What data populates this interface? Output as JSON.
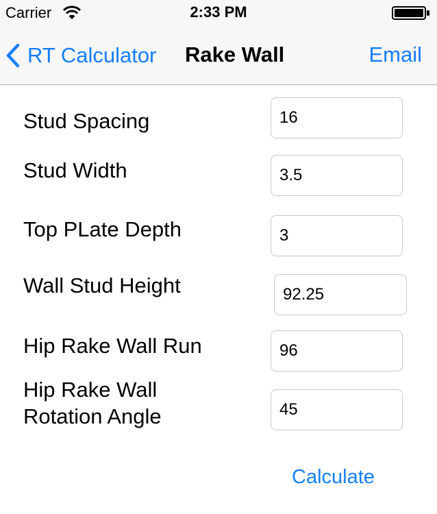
{
  "status_bar": {
    "carrier": "Carrier",
    "time": "2:33 PM"
  },
  "nav": {
    "back_label": "RT Calculator",
    "title": "Rake Wall",
    "email_label": "Email"
  },
  "form": {
    "stud_spacing": {
      "label": "Stud Spacing",
      "value": "16"
    },
    "stud_width": {
      "label": "Stud Width",
      "value": "3.5"
    },
    "top_plate_depth": {
      "label": "Top PLate Depth",
      "value": "3"
    },
    "wall_stud_height": {
      "label": "Wall Stud Height",
      "value": "92.25"
    },
    "hip_rake_wall_run": {
      "label": "Hip Rake Wall Run",
      "value": "96"
    },
    "hip_rake_wall_rotation_angle": {
      "label_line1": "Hip Rake Wall",
      "label_line2": "Rotation Angle",
      "value": "45"
    }
  },
  "actions": {
    "calculate_label": "Calculate"
  },
  "colors": {
    "accent": "#157efb",
    "bar_background": "#f7f7f8",
    "field_border": "#c8c8cc"
  },
  "icons": {
    "wifi": "wifi-icon",
    "battery": "battery-icon",
    "back": "chevron-left-icon"
  }
}
